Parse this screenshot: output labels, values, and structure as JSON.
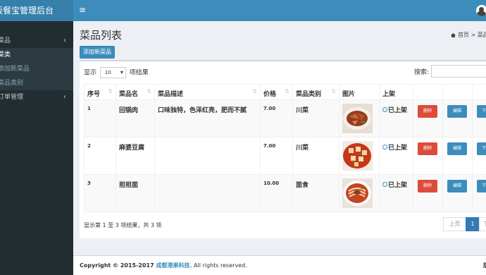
{
  "app": {
    "brand": "饭餐宝管理后台"
  },
  "header": {
    "toggle_icon": "≡"
  },
  "sidebar": {
    "items": [
      {
        "label": "菜品",
        "arrow": "‹"
      },
      {
        "label": "菜类",
        "active": true
      },
      {
        "label": "添加新菜品"
      },
      {
        "label": "菜品类别"
      },
      {
        "label": "订单管理",
        "arrow": "‹"
      }
    ]
  },
  "page": {
    "title": "菜品列表",
    "breadcrumb_home": "首页",
    "breadcrumb_current": "菜品",
    "add_button": "添加新菜品"
  },
  "table_controls": {
    "show_prefix": "显示",
    "page_size": "10",
    "show_suffix": "项结果",
    "search_label": "搜索:"
  },
  "table": {
    "columns": [
      "序号",
      "菜品名",
      "菜品描述",
      "价格",
      "菜品类别",
      "图片",
      "上架"
    ],
    "rows": [
      {
        "id": "1",
        "name": "回锅肉",
        "desc": "口味独特，色泽红亮，肥而不腻",
        "price": "7.00",
        "category": "川菜",
        "status": "已上架",
        "image": "twice-cooked-pork"
      },
      {
        "id": "2",
        "name": "麻婆豆腐",
        "desc": "",
        "price": "7.00",
        "category": "川菜",
        "status": "已上架",
        "image": "mapo-tofu"
      },
      {
        "id": "3",
        "name": "担担面",
        "desc": "",
        "price": "10.00",
        "category": "面食",
        "status": "已上架",
        "image": "dandan-noodles"
      }
    ],
    "delete_label": "删除",
    "edit_label": "编辑",
    "other_label": "下"
  },
  "pagination": {
    "info": "显示第 1 至 3 项结果，共 3 项",
    "prev": "上页",
    "current": "1",
    "next": "下"
  },
  "footer": {
    "copyright": "Copyright © 2015-2017 ",
    "company": "成都港果科技.",
    "rights": " All rights reserved.",
    "version": "版"
  },
  "colors": {
    "sidebar": "#222d32",
    "header": "#3c8dbc",
    "brand": "#367fa9",
    "danger": "#dd4b39",
    "primary": "#3c8dbc"
  }
}
